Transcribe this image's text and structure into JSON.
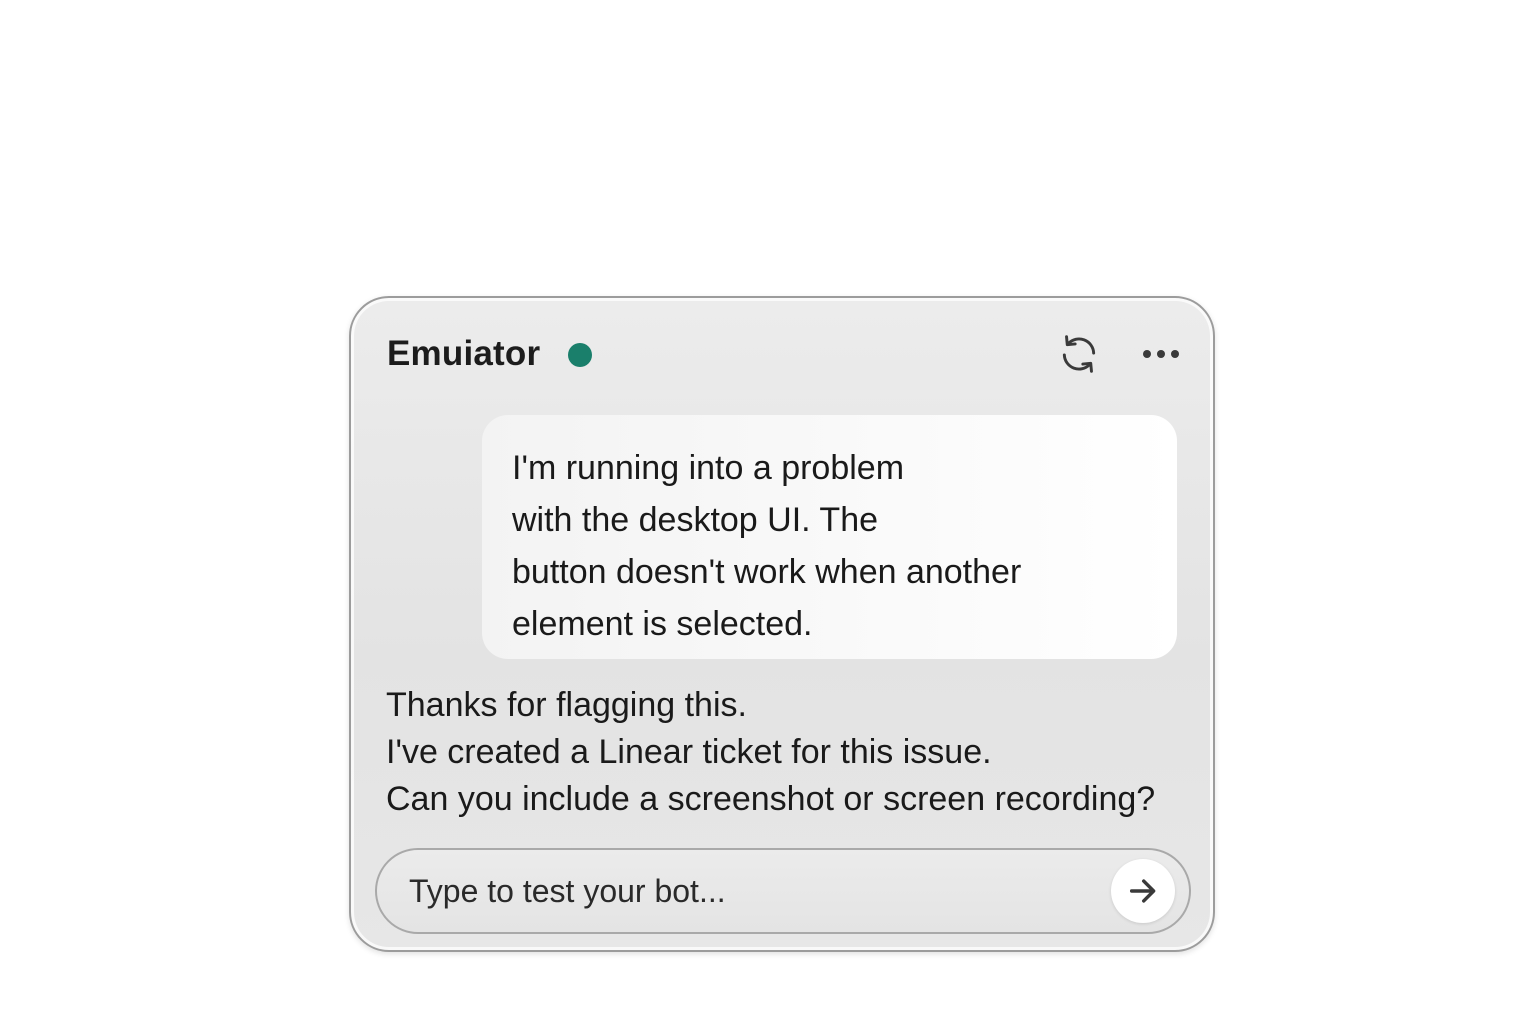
{
  "header": {
    "title": "Emuiator",
    "status_color": "#1a7f6b",
    "status_icon": "status-dot",
    "refresh_icon": "refresh-icon",
    "more_icon": "more-horizontal-icon"
  },
  "messages": {
    "user_lines": [
      "I'm running into a problem",
      "with the desktop UI. The",
      "button doesn't work when another",
      "element is selected."
    ],
    "bot_lines": [
      "Thanks for flagging this.",
      "I've created a Linear ticket for this issue.",
      "Can you include a screenshot or screen recording?"
    ]
  },
  "composer": {
    "placeholder": "Type to test your bot...",
    "value": "",
    "send_icon": "arrow-right-icon"
  },
  "colors": {
    "panel_background": "#e7e7e7",
    "bubble_background": "#f8f8f8",
    "text": "#1a1a1a"
  }
}
